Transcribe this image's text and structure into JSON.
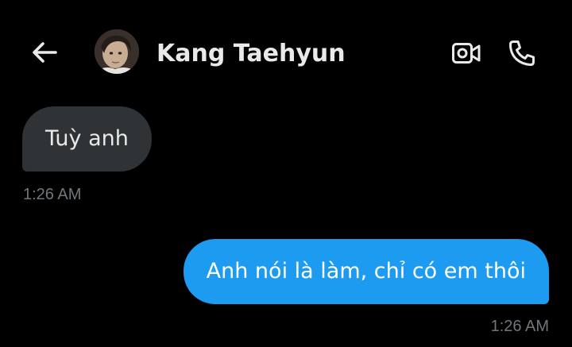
{
  "header": {
    "contact_name": "Kang Taehyun",
    "back_icon": "arrow-left-icon",
    "video_icon": "video-camera-icon",
    "call_icon": "phone-icon"
  },
  "messages": [
    {
      "direction": "received",
      "text": "Tuỳ anh",
      "time": "1:26 AM"
    },
    {
      "direction": "sent",
      "text": "Anh nói là làm, chỉ có em thôi",
      "time": "1:26 AM"
    }
  ],
  "colors": {
    "background": "#000000",
    "sent_bubble": "#1d9bf0",
    "received_bubble": "#2f3336",
    "timestamp": "#71767b",
    "text": "#e7e9ea"
  }
}
